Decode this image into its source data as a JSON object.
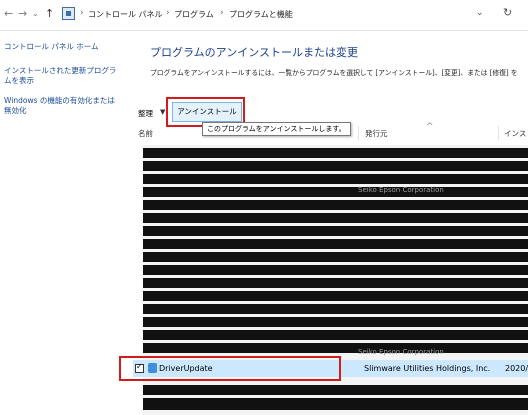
{
  "address_bar": {
    "back": "←",
    "forward": "→",
    "recent": "⌄",
    "up": "↑",
    "crumbs": [
      "コントロール パネル",
      "プログラム",
      "プログラムと機能"
    ],
    "separator": "›",
    "dropdown": "⌄",
    "refresh": "↻"
  },
  "sidebar": {
    "items": [
      {
        "label": "コントロール パネル ホーム"
      },
      {
        "label": "インストールされた更新プログラムを表示"
      },
      {
        "label": "Windows の機能の有効化または無効化"
      }
    ]
  },
  "main": {
    "title": "プログラムのアンインストールまたは変更",
    "description": "プログラムをアンインストールするには、一覧からプログラムを選択して [アンインストール]、[変更]、または [修復] を"
  },
  "toolbar": {
    "organize_label": "整理",
    "organize_caret": "▼",
    "uninstall_label": "アンインストール",
    "tooltip": "このプログラムをアンインストールします。"
  },
  "columns": {
    "name": "名前",
    "publisher": "発行元",
    "installed": "インス",
    "sort_indicator": "^"
  },
  "background_rows": [
    "Seiko Epson Corporation",
    "Seiko Epson Corporation"
  ],
  "selected_row": {
    "checked": true,
    "name": "DriverUpdate",
    "publisher": "Slimware Utilities Holdings, Inc.",
    "installed_on": "2020/"
  },
  "colors": {
    "highlight": "#d01c1c",
    "selection": "#cce8ff",
    "link": "#1a4b9b",
    "title": "#1c3f8c"
  }
}
